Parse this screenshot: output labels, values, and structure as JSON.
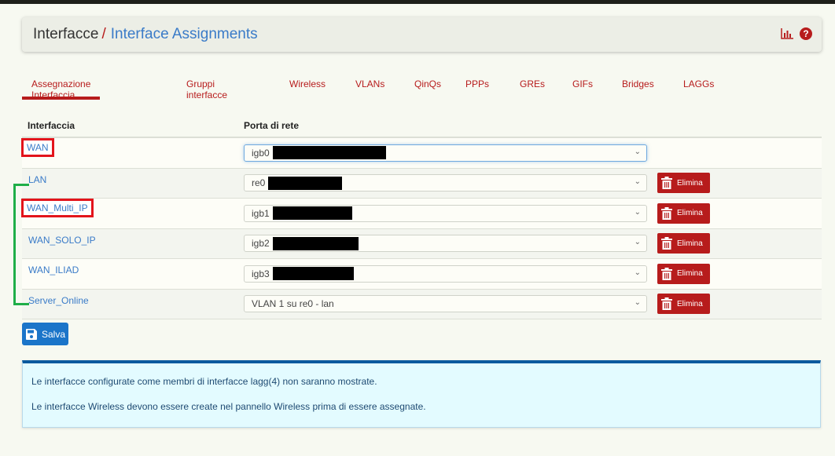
{
  "header": {
    "breadcrumb_root": "Interfacce",
    "breadcrumb_separator": "/",
    "breadcrumb_leaf": "Interface Assignments",
    "icons": [
      "chart-icon",
      "help-icon"
    ],
    "help_glyph": "?"
  },
  "tabs": [
    {
      "label": "Assegnazione Interfaccia",
      "active": true
    },
    {
      "label": "Gruppi interfacce",
      "active": false
    },
    {
      "label": "Wireless",
      "active": false
    },
    {
      "label": "VLANs",
      "active": false
    },
    {
      "label": "QinQs",
      "active": false
    },
    {
      "label": "PPPs",
      "active": false
    },
    {
      "label": "GREs",
      "active": false
    },
    {
      "label": "GIFs",
      "active": false
    },
    {
      "label": "Bridges",
      "active": false
    },
    {
      "label": "LAGGs",
      "active": false
    }
  ],
  "table": {
    "headers": {
      "interface": "Interfaccia",
      "port": "Porta di rete"
    },
    "rows": [
      {
        "interface": "WAN",
        "port": "igb0",
        "redacted": true,
        "deletable": false,
        "highlighted": true
      },
      {
        "interface": "LAN",
        "port": "re0",
        "redacted": true,
        "deletable": true,
        "highlighted": false
      },
      {
        "interface": "WAN_Multi_IP",
        "port": "igb1",
        "redacted": true,
        "deletable": true,
        "highlighted": true
      },
      {
        "interface": "WAN_SOLO_IP",
        "port": "igb2",
        "redacted": true,
        "deletable": true,
        "highlighted": false
      },
      {
        "interface": "WAN_ILIAD",
        "port": "igb3",
        "redacted": true,
        "deletable": true,
        "highlighted": false
      },
      {
        "interface": "Server_Online",
        "port": "VLAN 1 su re0 - lan",
        "redacted": false,
        "deletable": true,
        "highlighted": false
      }
    ],
    "delete_label": "Elimina"
  },
  "actions": {
    "save_label": "Salva"
  },
  "info": {
    "line1": "Le interfacce configurate come membri di interfacce lagg(4) non saranno mostrate.",
    "line2": "Le interfacce Wireless devono essere create nel pannello Wireless prima di essere assegnate."
  },
  "colors": {
    "accent_red": "#b71c1c",
    "link_blue": "#3a7bc8",
    "save_blue": "#1b75c9",
    "annotation_red": "#e3141b",
    "annotation_green": "#1fae48",
    "info_border": "#0b5a9e"
  }
}
